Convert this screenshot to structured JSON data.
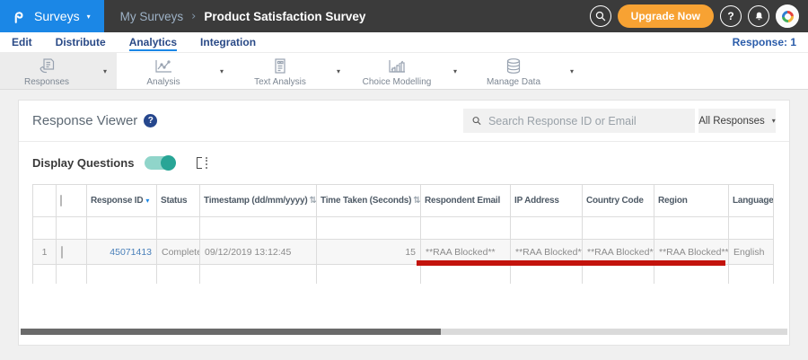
{
  "topbar": {
    "product_label": "Surveys",
    "breadcrumb": {
      "parent": "My Surveys",
      "separator": "›",
      "current": "Product Satisfaction Survey"
    },
    "upgrade_label": "Upgrade Now"
  },
  "nav": {
    "items": [
      {
        "label": "Edit",
        "active": false
      },
      {
        "label": "Distribute",
        "active": false
      },
      {
        "label": "Analytics",
        "active": true
      },
      {
        "label": "Integration",
        "active": false
      }
    ],
    "response_counter": "Response: 1"
  },
  "toolbar": {
    "items": [
      {
        "label": "Responses",
        "icon": "responses-icon",
        "active": true
      },
      {
        "label": "Analysis",
        "icon": "analysis-icon",
        "active": false
      },
      {
        "label": "Text Analysis",
        "icon": "text-analysis-icon",
        "active": false
      },
      {
        "label": "Choice Modelling",
        "icon": "choice-modelling-icon",
        "active": false
      },
      {
        "label": "Manage Data",
        "icon": "manage-data-icon",
        "active": false
      }
    ]
  },
  "viewer": {
    "title": "Response Viewer",
    "search": {
      "placeholder": "Search Response ID or Email",
      "value": ""
    },
    "filter_dropdown": {
      "selected": "All Responses"
    },
    "display_questions": {
      "label": "Display Questions",
      "enabled": true
    }
  },
  "table": {
    "columns": [
      {
        "label": ""
      },
      {
        "label": ""
      },
      {
        "label": "Response ID",
        "sort": "desc"
      },
      {
        "label": "Status",
        "sort": null
      },
      {
        "label": "Timestamp (dd/mm/yyyy)",
        "sort": "both"
      },
      {
        "label": "Time Taken (Seconds)",
        "sort": "both"
      },
      {
        "label": "Respondent Email",
        "sort": null
      },
      {
        "label": "IP Address",
        "sort": null
      },
      {
        "label": "Country Code",
        "sort": null
      },
      {
        "label": "Region",
        "sort": null
      },
      {
        "label": "Language",
        "sort": null
      }
    ],
    "rows": [
      {
        "index": "1",
        "response_id": "45071413",
        "status": "Completed",
        "timestamp": "09/12/2019 13:12:45",
        "time_taken": "15",
        "respondent_email": "**RAA Blocked**",
        "ip_address": "**RAA Blocked**",
        "country_code": "**RAA Blocked**",
        "region": "**RAA Blocked**",
        "language": "English"
      }
    ]
  },
  "icons": {
    "caret_down": "▾",
    "sort_desc": "▾",
    "sort_both": "⇅",
    "help_glyph": "?"
  },
  "colors": {
    "brand_blue": "#1b87e6",
    "topbar_bg": "#3b3b3b",
    "upgrade_orange": "#f7a233",
    "toggle_teal": "#28a596",
    "annotation_red": "#c3130c",
    "id_link_blue": "#4a80ba",
    "nav_navy": "#2a4a87"
  }
}
